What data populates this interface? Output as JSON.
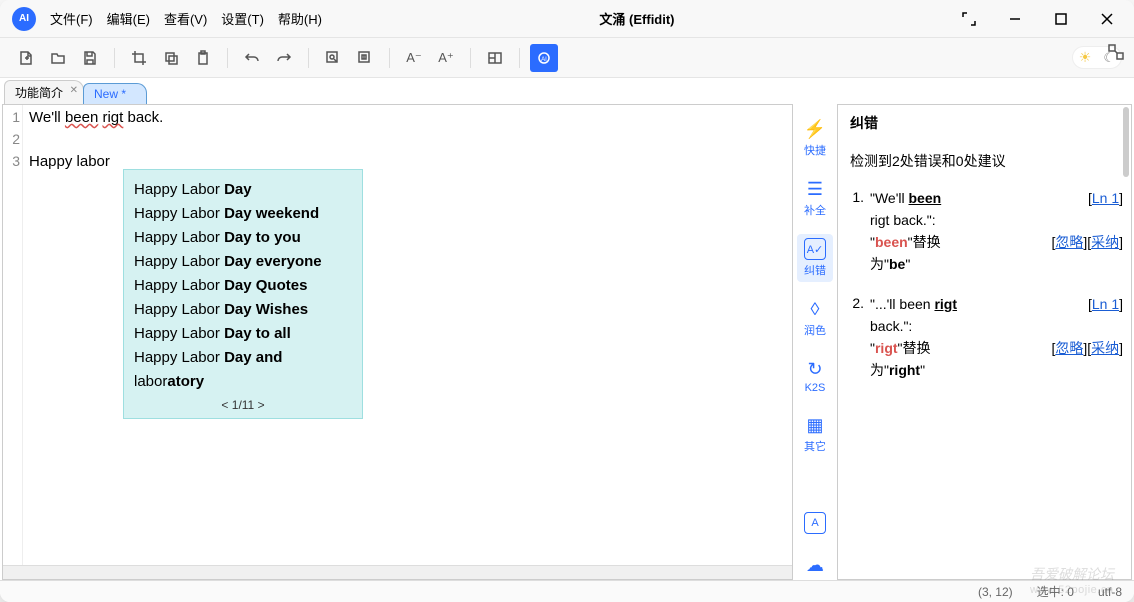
{
  "title": "文涌 (Effidit)",
  "menus": {
    "file": "文件(F)",
    "edit": "编辑(E)",
    "view": "查看(V)",
    "settings": "设置(T)",
    "help": "帮助(H)"
  },
  "tabs": {
    "intro": "功能简介",
    "new": "New *"
  },
  "editor": {
    "lines": {
      "1": "1",
      "2": "2",
      "3": "3"
    },
    "l1_pre": "We'll ",
    "l1_err1": "been",
    "l1_mid": " ",
    "l1_err2": "rigt",
    "l1_post": " back.",
    "l3": "Happy labor"
  },
  "suggestions": {
    "prefix": "Happy Labor ",
    "items": [
      "Day",
      "Day weekend",
      "Day to you",
      "Day everyone",
      "Day Quotes",
      "Day Wishes",
      "Day to all",
      "Day and"
    ],
    "last_pre": "labor",
    "last_bold": "atory",
    "pager": "< 1/11 >"
  },
  "rail": {
    "quick": "快捷",
    "complete": "补全",
    "correct": "纠错",
    "polish": "润色",
    "k2s": "K2S",
    "other": "其它"
  },
  "panel": {
    "title": "纠错",
    "summary": "检测到2处错误和0处建议",
    "ln1": "Ln 1",
    "ignore": "忽略",
    "accept": "采纳",
    "e1_l1a": "\"We'll ",
    "e1_l1b": "been",
    "e1_l2": "rigt back.\":",
    "e1_l3a": "\"",
    "e1_l3b": "been",
    "e1_l3c": "\"替换",
    "e1_l4a": "为\"",
    "e1_l4b": "be",
    "e1_l4c": "\"",
    "e2_l1a": "\"...'ll been ",
    "e2_l1b": "rigt",
    "e2_l2": "back.\":",
    "e2_l3a": "\"",
    "e2_l3b": "rigt",
    "e2_l3c": "\"替换",
    "e2_l4a": "为\"",
    "e2_l4b": "right",
    "e2_l4c": "\""
  },
  "status": {
    "pos": "(3, 12)",
    "sel": "选中: 0",
    "enc": "utf-8"
  },
  "watermark": {
    "l1": "吾爱破解论坛",
    "l2": "www.52pojie.cn"
  }
}
